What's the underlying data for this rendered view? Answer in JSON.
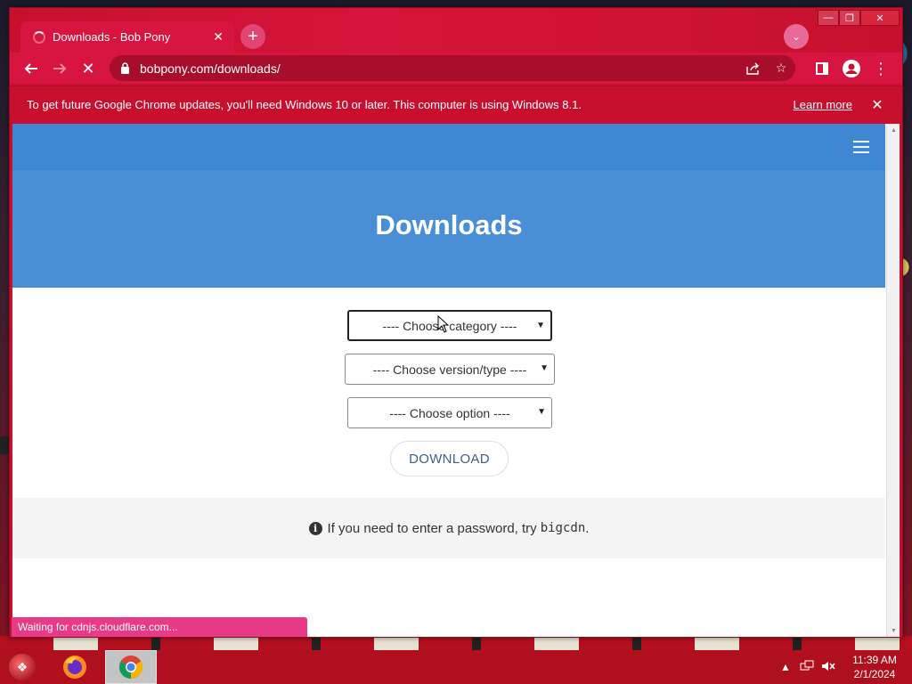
{
  "browser": {
    "tab_title": "Downloads - Bob Pony",
    "url": "bobpony.com/downloads/",
    "infobar_message": "To get future Google Chrome updates, you'll need Windows 10 or later. This computer is using Windows 8.1.",
    "infobar_link": "Learn more",
    "status_text": "Waiting for cdnjs.cloudflare.com...",
    "theme_color": "#c8102e"
  },
  "page": {
    "title": "Downloads",
    "header_color": "#4a8fd6",
    "category_select": "---- Choose category ----",
    "version_select": "---- Choose version/type ----",
    "option_select": "---- Choose option ----",
    "download_button": "DOWNLOAD",
    "password_hint_prefix": "If you need to enter a password, try",
    "password_value": "bigcdn",
    "password_hint_suffix": "."
  },
  "taskbar": {
    "apps": [
      "firefox-icon",
      "chrome-icon"
    ],
    "time": "11:39 AM",
    "date": "2/1/2024"
  }
}
